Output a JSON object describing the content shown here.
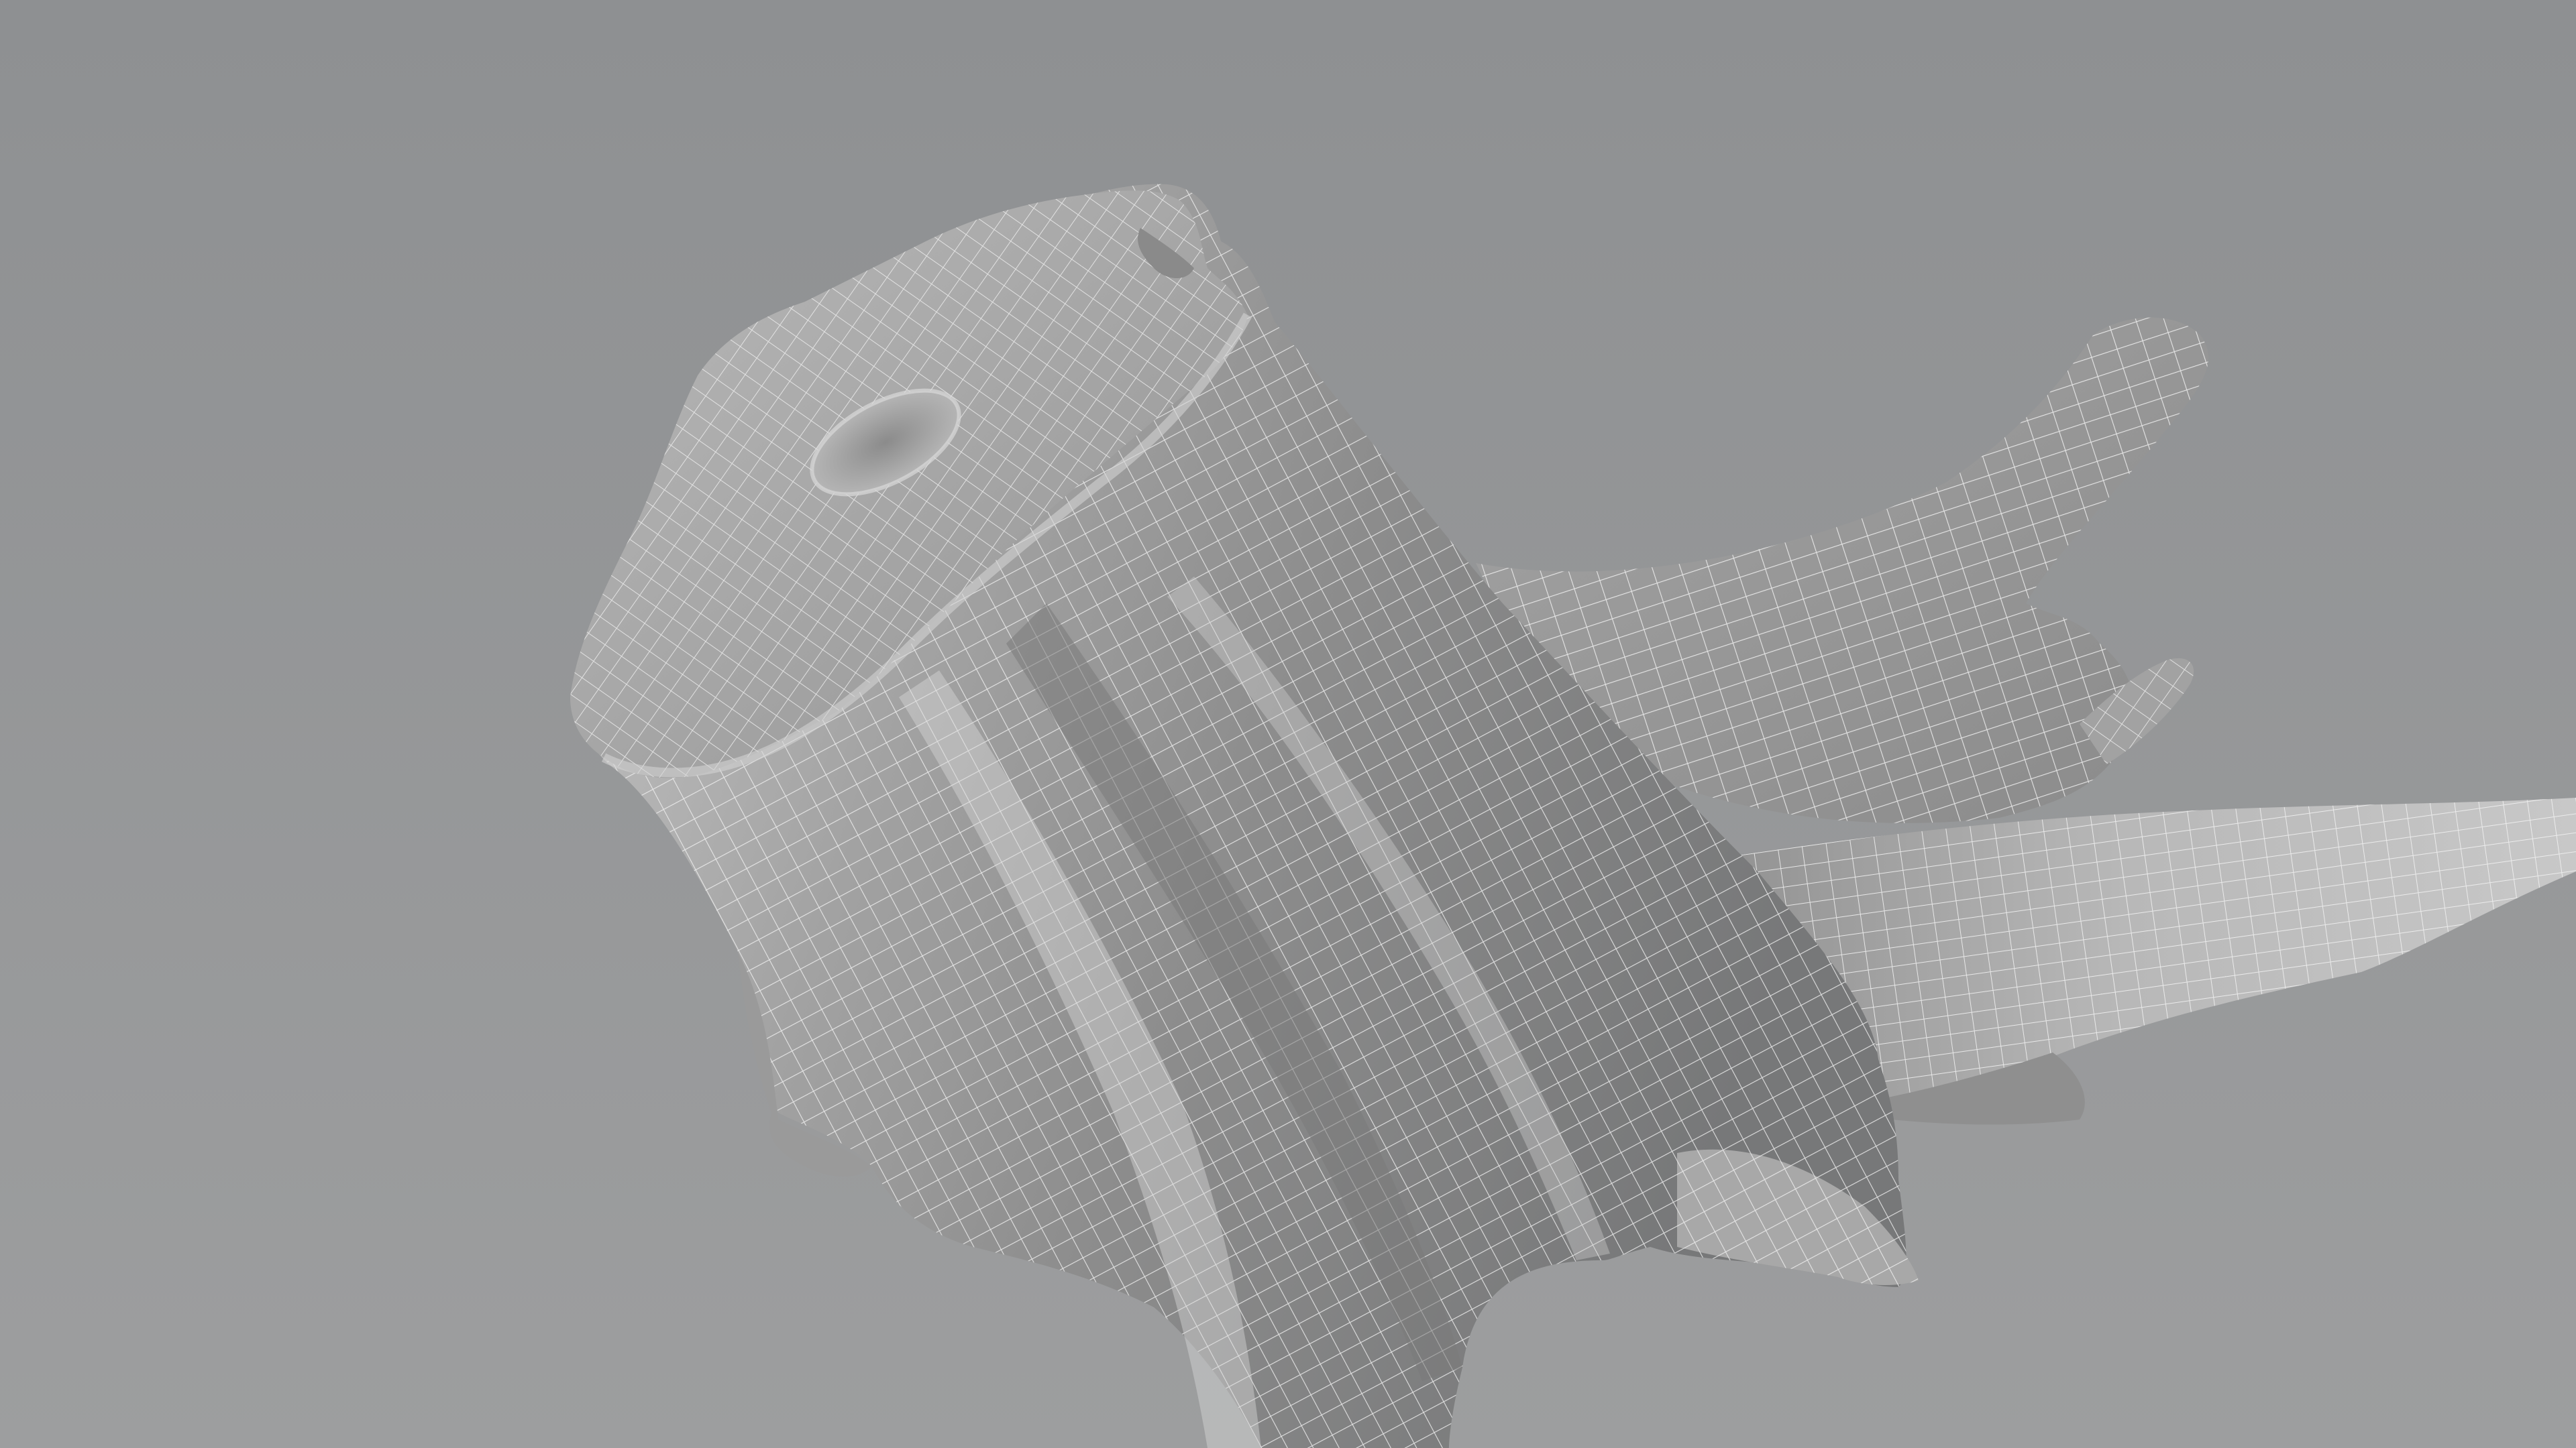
{
  "scene": {
    "subject": "tree-stump-wireframe-mesh",
    "colors": {
      "background_top": "#8f9193",
      "background_bottom": "#9b9c9d",
      "mesh_light": "#d9d9d9",
      "mesh_mid": "#a9a9a9",
      "mesh_dark": "#6f7071",
      "wire": "#f2f2f2"
    }
  }
}
